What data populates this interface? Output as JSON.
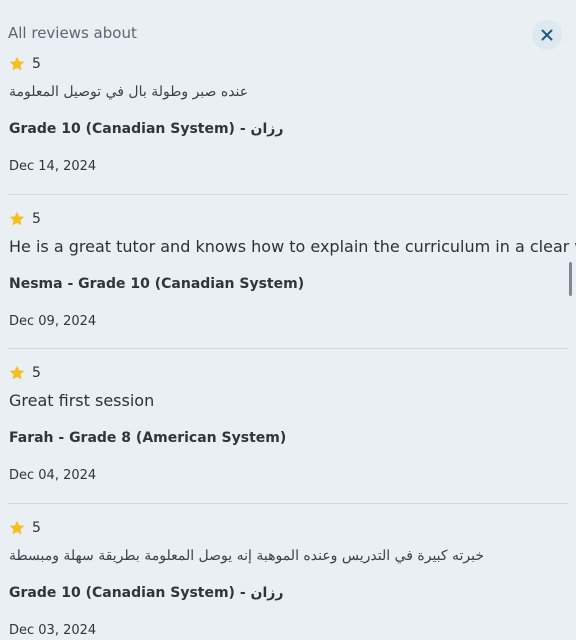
{
  "header": {
    "title": "All reviews about",
    "close_icon": "close-icon"
  },
  "colors": {
    "background": "#e9eff3",
    "star": "#f5bf1f",
    "close_icon": "#1f5b7a"
  },
  "reviews": [
    {
      "rating": "5",
      "comment": "عنده صبر وطولة بال في توصيل المعلومة",
      "author": "Grade 10 (Canadian System) - رزان",
      "date": "Dec 14, 2024"
    },
    {
      "rating": "5",
      "comment": "He is a great tutor and knows how to explain the curriculum in a clear way",
      "author": "Nesma - Grade 10 (Canadian System)",
      "date": "Dec 09, 2024"
    },
    {
      "rating": "5",
      "comment": "Great first session",
      "author": "Farah - Grade 8 (American System)",
      "date": "Dec 04, 2024"
    },
    {
      "rating": "5",
      "comment": "خبرته كبيرة في التدريس وعنده الموهبة إنه يوصل المعلومة بطريقة سهلة ومبسطة",
      "author": "Grade 10 (Canadian System) - رزان",
      "date": "Dec 03, 2024"
    }
  ]
}
